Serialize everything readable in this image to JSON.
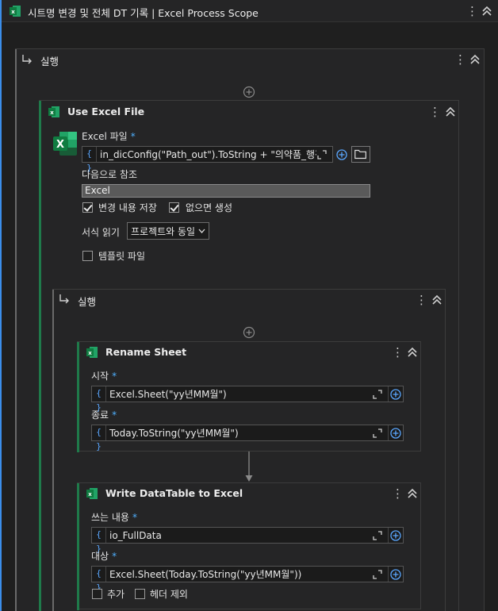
{
  "scope": {
    "title": "시트명 변경 및 전체 DT 기록 | Excel Process Scope",
    "run_label": "실행"
  },
  "use_excel": {
    "title": "Use Excel File",
    "file_label": "Excel 파일",
    "file_value": "in_dicConfig(\"Path_out\").ToString + \"의약품_행정",
    "ref_label": "다음으로 참조",
    "ref_value": "Excel",
    "save_changes_label": "변경 내용 저장",
    "create_if_missing_label": "없으면 생성",
    "read_format_label": "서식 읽기",
    "read_format_value": "프로젝트와 동일",
    "template_label": "템플릿 파일",
    "save_changes_checked": true,
    "create_if_missing_checked": true,
    "template_checked": false
  },
  "inner_run": {
    "label": "실행"
  },
  "rename_sheet": {
    "title": "Rename Sheet",
    "start_label": "시작",
    "start_value": "Excel.Sheet(\"yy년MM월\")",
    "end_label": "종료",
    "end_value": "Today.ToString(\"yy년MM월\")"
  },
  "write_dt": {
    "title": "Write DataTable to Excel",
    "content_label": "쓰는 내용",
    "content_value": "io_FullData",
    "target_label": "대상",
    "target_value": "Excel.Sheet(Today.ToString(\"yy년MM월\"))",
    "append_label": "추가",
    "exclude_header_label": "헤더 제외",
    "append_checked": false,
    "exclude_header_checked": false
  },
  "colors": {
    "accent": "#3b8eea",
    "excel_green": "#1f7a4a",
    "required": "#4fb0ff"
  }
}
